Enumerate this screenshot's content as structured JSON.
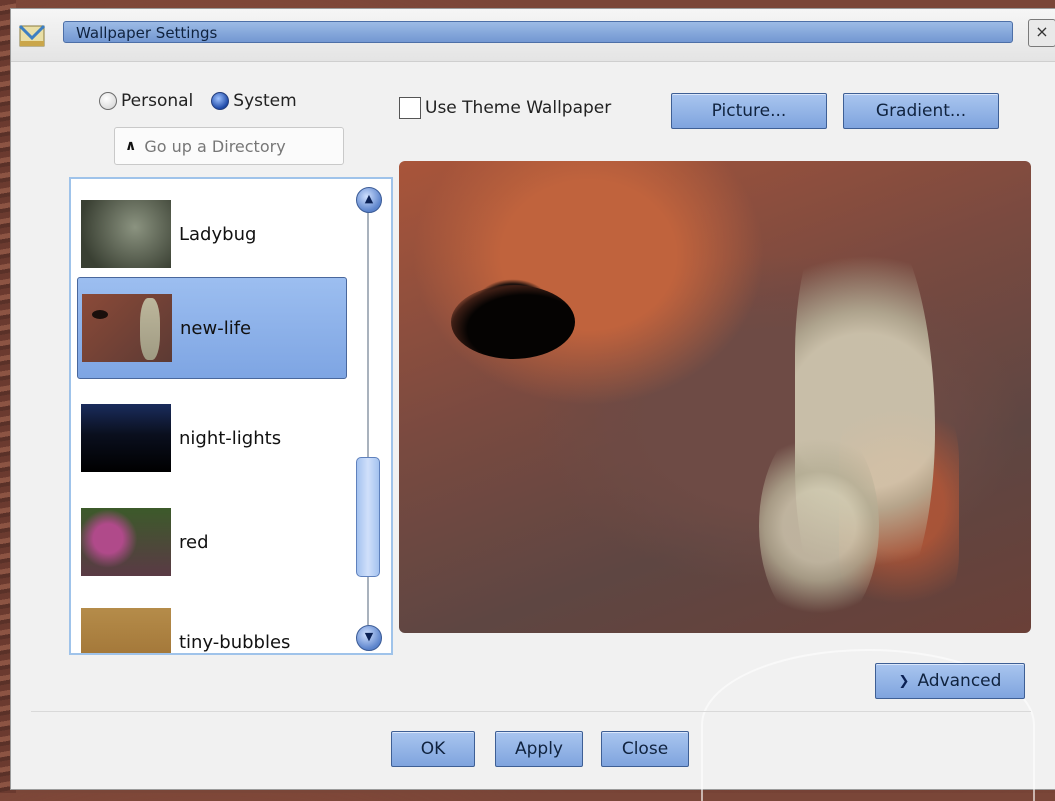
{
  "window": {
    "title": "Wallpaper Settings",
    "close_glyph": "×"
  },
  "source": {
    "personal_label": "Personal",
    "system_label": "System",
    "selected": "System"
  },
  "directory": {
    "up_label": "Go up a Directory",
    "up_icon": "chevron-up-icon"
  },
  "options": {
    "use_theme_label": "Use Theme Wallpaper",
    "use_theme_checked": false,
    "picture_button": "Picture...",
    "gradient_button": "Gradient..."
  },
  "wallpapers": [
    {
      "label": "Ladybug",
      "selected": false
    },
    {
      "label": "new-life",
      "selected": true
    },
    {
      "label": "night-lights",
      "selected": false
    },
    {
      "label": "red",
      "selected": false
    },
    {
      "label": "tiny-bubbles",
      "selected": false
    }
  ],
  "advanced_button": "Advanced",
  "footer": {
    "ok": "OK",
    "apply": "Apply",
    "close": "Close"
  },
  "colors": {
    "button_face": "#8fb0e6",
    "selection": "#8fb1e9",
    "list_border": "#9fc3ea"
  }
}
